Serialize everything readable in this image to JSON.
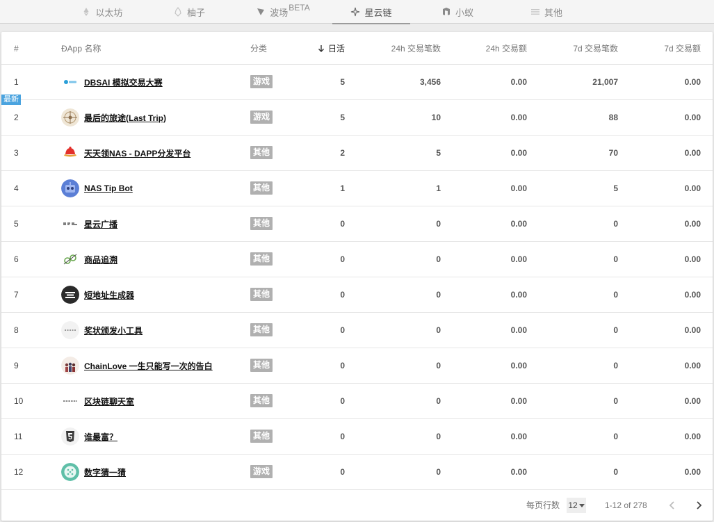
{
  "tabs": [
    {
      "label": "以太坊",
      "icon": "ethereum-icon",
      "sup": ""
    },
    {
      "label": "柚子",
      "icon": "eos-icon",
      "sup": ""
    },
    {
      "label": "波场",
      "icon": "tron-icon",
      "sup": "BETA"
    },
    {
      "label": "星云链",
      "icon": "nebulas-icon",
      "sup": ""
    },
    {
      "label": "小蚁",
      "icon": "neo-icon",
      "sup": ""
    },
    {
      "label": "其他",
      "icon": "menu-icon",
      "sup": ""
    }
  ],
  "active_tab": 3,
  "table": {
    "headers": {
      "rank": "#",
      "name": "ĐApp 名称",
      "category": "分类",
      "dau": "日活",
      "tx24": "24h 交易笔数",
      "vol24": "24h 交易额",
      "tx7d": "7d 交易笔数",
      "vol7d": "7d 交易额"
    },
    "new_badge": "最新",
    "rows": [
      {
        "rank": "1",
        "name": "DBSAI 模拟交易大赛",
        "category": "游戏",
        "dau": "5",
        "tx24": "3,456",
        "vol24": "0.00",
        "tx7d": "21,007",
        "vol7d": "0.00",
        "icon": "dbsai-logo-icon"
      },
      {
        "rank": "2",
        "name": "最后的旅途(Last Trip)",
        "category": "游戏",
        "dau": "5",
        "tx24": "10",
        "vol24": "0.00",
        "tx7d": "88",
        "vol7d": "0.00",
        "icon": "compass-logo-icon",
        "is_new": true
      },
      {
        "rank": "3",
        "name": "天天领NAS - DAPP分发平台",
        "category": "其他",
        "dau": "2",
        "tx24": "5",
        "vol24": "0.00",
        "tx7d": "70",
        "vol7d": "0.00",
        "icon": "red-hat-logo-icon"
      },
      {
        "rank": "4",
        "name": "NAS Tip Bot",
        "category": "其他",
        "dau": "1",
        "tx24": "1",
        "vol24": "0.00",
        "tx7d": "5",
        "vol7d": "0.00",
        "icon": "robot-logo-icon"
      },
      {
        "rank": "5",
        "name": "星云广播",
        "category": "其他",
        "dau": "0",
        "tx24": "0",
        "vol24": "0.00",
        "tx7d": "0",
        "vol7d": "0.00",
        "icon": "broadcast-logo-icon"
      },
      {
        "rank": "6",
        "name": "商品追溯",
        "category": "其他",
        "dau": "0",
        "tx24": "0",
        "vol24": "0.00",
        "tx7d": "0",
        "vol7d": "0.00",
        "icon": "trace-logo-icon"
      },
      {
        "rank": "7",
        "name": "短地址生成器",
        "category": "其他",
        "dau": "0",
        "tx24": "0",
        "vol24": "0.00",
        "tx7d": "0",
        "vol7d": "0.00",
        "icon": "short-url-logo-icon"
      },
      {
        "rank": "8",
        "name": "奖状颁发小工具",
        "category": "其他",
        "dau": "0",
        "tx24": "0",
        "vol24": "0.00",
        "tx7d": "0",
        "vol7d": "0.00",
        "icon": "certificate-logo-icon"
      },
      {
        "rank": "9",
        "name": "ChainLove 一生只能写一次的告白",
        "category": "其他",
        "dau": "0",
        "tx24": "0",
        "vol24": "0.00",
        "tx7d": "0",
        "vol7d": "0.00",
        "icon": "people-logo-icon"
      },
      {
        "rank": "10",
        "name": "区块链聊天室",
        "category": "其他",
        "dau": "0",
        "tx24": "0",
        "vol24": "0.00",
        "tx7d": "0",
        "vol7d": "0.00",
        "icon": "chatroom-logo-icon"
      },
      {
        "rank": "11",
        "name": "谁最富？",
        "category": "其他",
        "dau": "0",
        "tx24": "0",
        "vol24": "0.00",
        "tx7d": "0",
        "vol7d": "0.00",
        "icon": "html5-logo-icon"
      },
      {
        "rank": "12",
        "name": "数字猜一猜",
        "category": "游戏",
        "dau": "0",
        "tx24": "0",
        "vol24": "0.00",
        "tx7d": "0",
        "vol7d": "0.00",
        "icon": "dice-logo-icon"
      }
    ]
  },
  "pagination": {
    "rows_per_page_label": "每页行数",
    "rows_per_page": "12",
    "range": "1-12 of 278"
  },
  "colors": {
    "tab_bar_bg": "#f5f5f5",
    "category_badge": "#b0b0b0",
    "new_badge": "#4aa3df"
  }
}
